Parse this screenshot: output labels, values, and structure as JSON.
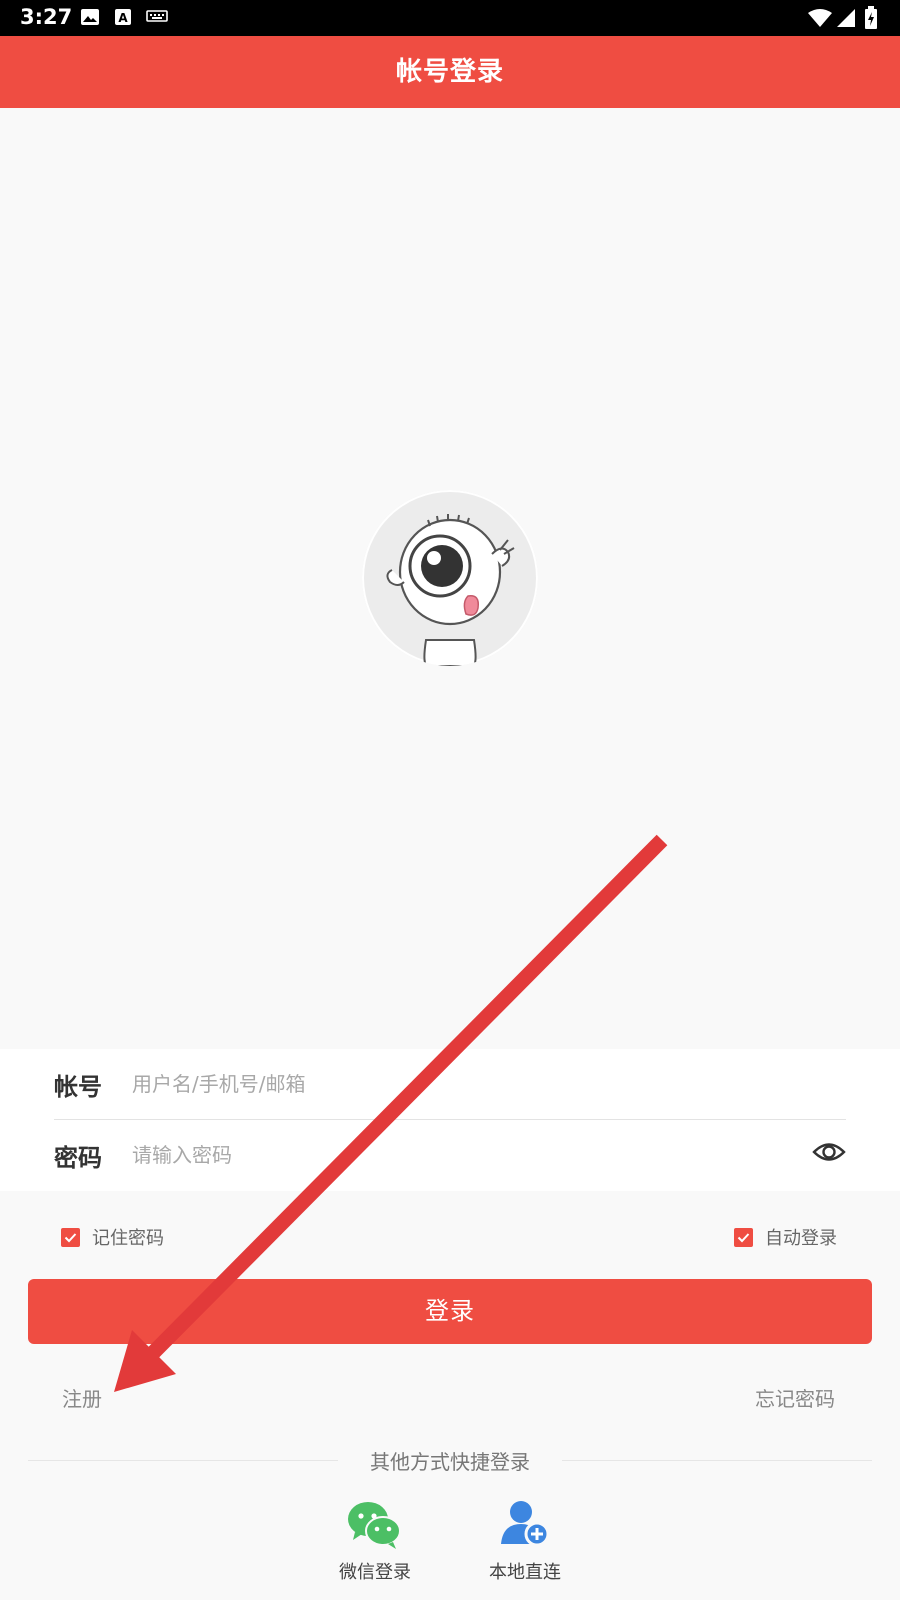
{
  "status_bar": {
    "time": "3:27",
    "icons": [
      "image-icon",
      "font-a-icon",
      "keyboard-icon",
      "wifi-icon",
      "signal-icon",
      "battery-icon"
    ]
  },
  "app_bar": {
    "title": "帐号登录"
  },
  "avatar": {
    "icon": "cartoon-eyeball-avatar"
  },
  "form": {
    "account": {
      "label": "帐号",
      "placeholder": "用户名/手机号/邮箱",
      "value": ""
    },
    "password": {
      "label": "密码",
      "placeholder": "请输入密码",
      "value": "",
      "toggle_icon": "eye-icon"
    }
  },
  "options": {
    "remember_password": {
      "label": "记住密码",
      "checked": true
    },
    "auto_login": {
      "label": "自动登录",
      "checked": true
    }
  },
  "login_button": {
    "label": "登录"
  },
  "links": {
    "register": "注册",
    "forgot_password": "忘记密码"
  },
  "other_login": {
    "title": "其他方式快捷登录",
    "items": [
      {
        "label": "微信登录",
        "icon": "wechat-icon"
      },
      {
        "label": "本地直连",
        "icon": "user-add-icon"
      }
    ]
  },
  "colors": {
    "accent": "#ef4d42",
    "status_bar": "#000000",
    "background": "#f9f9f9",
    "wechat": "#4cbf65",
    "user_icon": "#3d86e0",
    "annotation_arrow": "#e23a3a"
  }
}
